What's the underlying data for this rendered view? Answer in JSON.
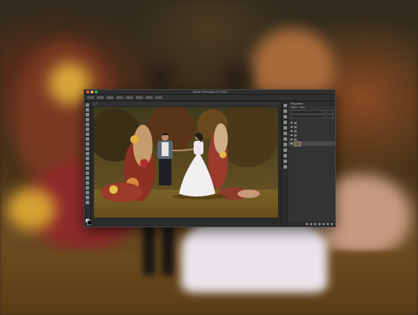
{
  "window": {
    "title": "Adobe Photoshop CC 2018",
    "document_tab": "",
    "status": ""
  },
  "options_bar": {
    "zoom_label": ""
  },
  "properties_panel": {
    "title": "Properties",
    "tabs": [
      "Layers",
      "Paths"
    ]
  },
  "layers_panel": {
    "items": [
      {
        "name": "",
        "type": "group"
      },
      {
        "name": "",
        "type": "group"
      },
      {
        "name": "",
        "type": "group"
      },
      {
        "name": "",
        "type": "group"
      },
      {
        "name": "",
        "type": "group"
      },
      {
        "name": "",
        "type": "image",
        "selected": true
      }
    ]
  },
  "colors": {
    "app_bg": "#262626",
    "panel_bg": "#333333",
    "selection": "#4a4a4a",
    "close_btn": "#ff5f57",
    "min_btn": "#febc2e",
    "max_btn": "#28c840"
  },
  "icons": {
    "tools": [
      "move-icon",
      "marquee-icon",
      "lasso-icon",
      "quick-select-icon",
      "crop-icon",
      "eyedropper-icon",
      "healing-icon",
      "brush-icon",
      "clone-icon",
      "history-brush-icon",
      "eraser-icon",
      "gradient-icon",
      "blur-icon",
      "dodge-icon",
      "pen-icon",
      "type-icon",
      "path-select-icon",
      "shape-icon",
      "hand-icon",
      "zoom-icon",
      "more-tools-icon"
    ],
    "panel_strip": [
      "history-icon",
      "properties-icon",
      "adjustments-icon",
      "layers-icon",
      "channels-icon",
      "paths-icon",
      "swatches-icon",
      "brush-settings-icon",
      "character-icon",
      "paragraph-icon",
      "info-icon",
      "navigator-icon"
    ]
  }
}
